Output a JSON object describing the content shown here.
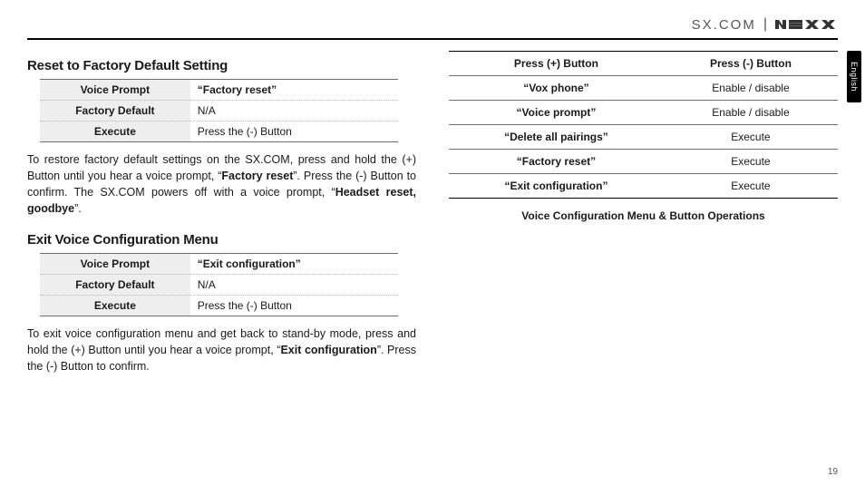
{
  "header": {
    "brand": "SX.COM",
    "sep": "|",
    "logo_label": "nexx-logo"
  },
  "side_tab": "English",
  "page_number": "19",
  "left": {
    "section1": {
      "heading": "Reset to Factory Default Setting",
      "rows": [
        {
          "k": "Voice Prompt",
          "v": "“Factory reset”"
        },
        {
          "k": "Factory Default",
          "v": "N/A"
        },
        {
          "k": "Execute",
          "v": "Press the (-) Button"
        }
      ],
      "para_parts": [
        "To restore factory default settings on the SX.COM, press and hold the (+) Button until you hear a voice prompt, “",
        "Factory reset",
        "”. Press the (-) Button to confirm. The SX.COM powers off with a voice prompt, “",
        "Headset reset, goodbye",
        "”."
      ]
    },
    "section2": {
      "heading": "Exit Voice Configuration Menu",
      "rows": [
        {
          "k": "Voice Prompt",
          "v": "“Exit configuration”"
        },
        {
          "k": "Factory Default",
          "v": "N/A"
        },
        {
          "k": "Execute",
          "v": "Press the (-) Button"
        }
      ],
      "para_parts": [
        "To exit voice configuration menu and get back to stand-by mode, press and hold the (+) Button until you hear a voice prompt, “",
        "Exit configuration",
        "”. Press the (-) Button to confirm."
      ]
    }
  },
  "right": {
    "headers": [
      "Press (+) Button",
      "Press (-) Button"
    ],
    "rows": [
      {
        "a": "“Vox phone”",
        "b": "Enable / disable"
      },
      {
        "a": "“Voice prompt”",
        "b": "Enable / disable"
      },
      {
        "a": "“Delete all pairings”",
        "b": "Execute"
      },
      {
        "a": "“Factory reset”",
        "b": "Execute"
      },
      {
        "a": "“Exit configuration”",
        "b": "Execute"
      }
    ],
    "caption": "Voice Configuration Menu & Button Operations"
  }
}
